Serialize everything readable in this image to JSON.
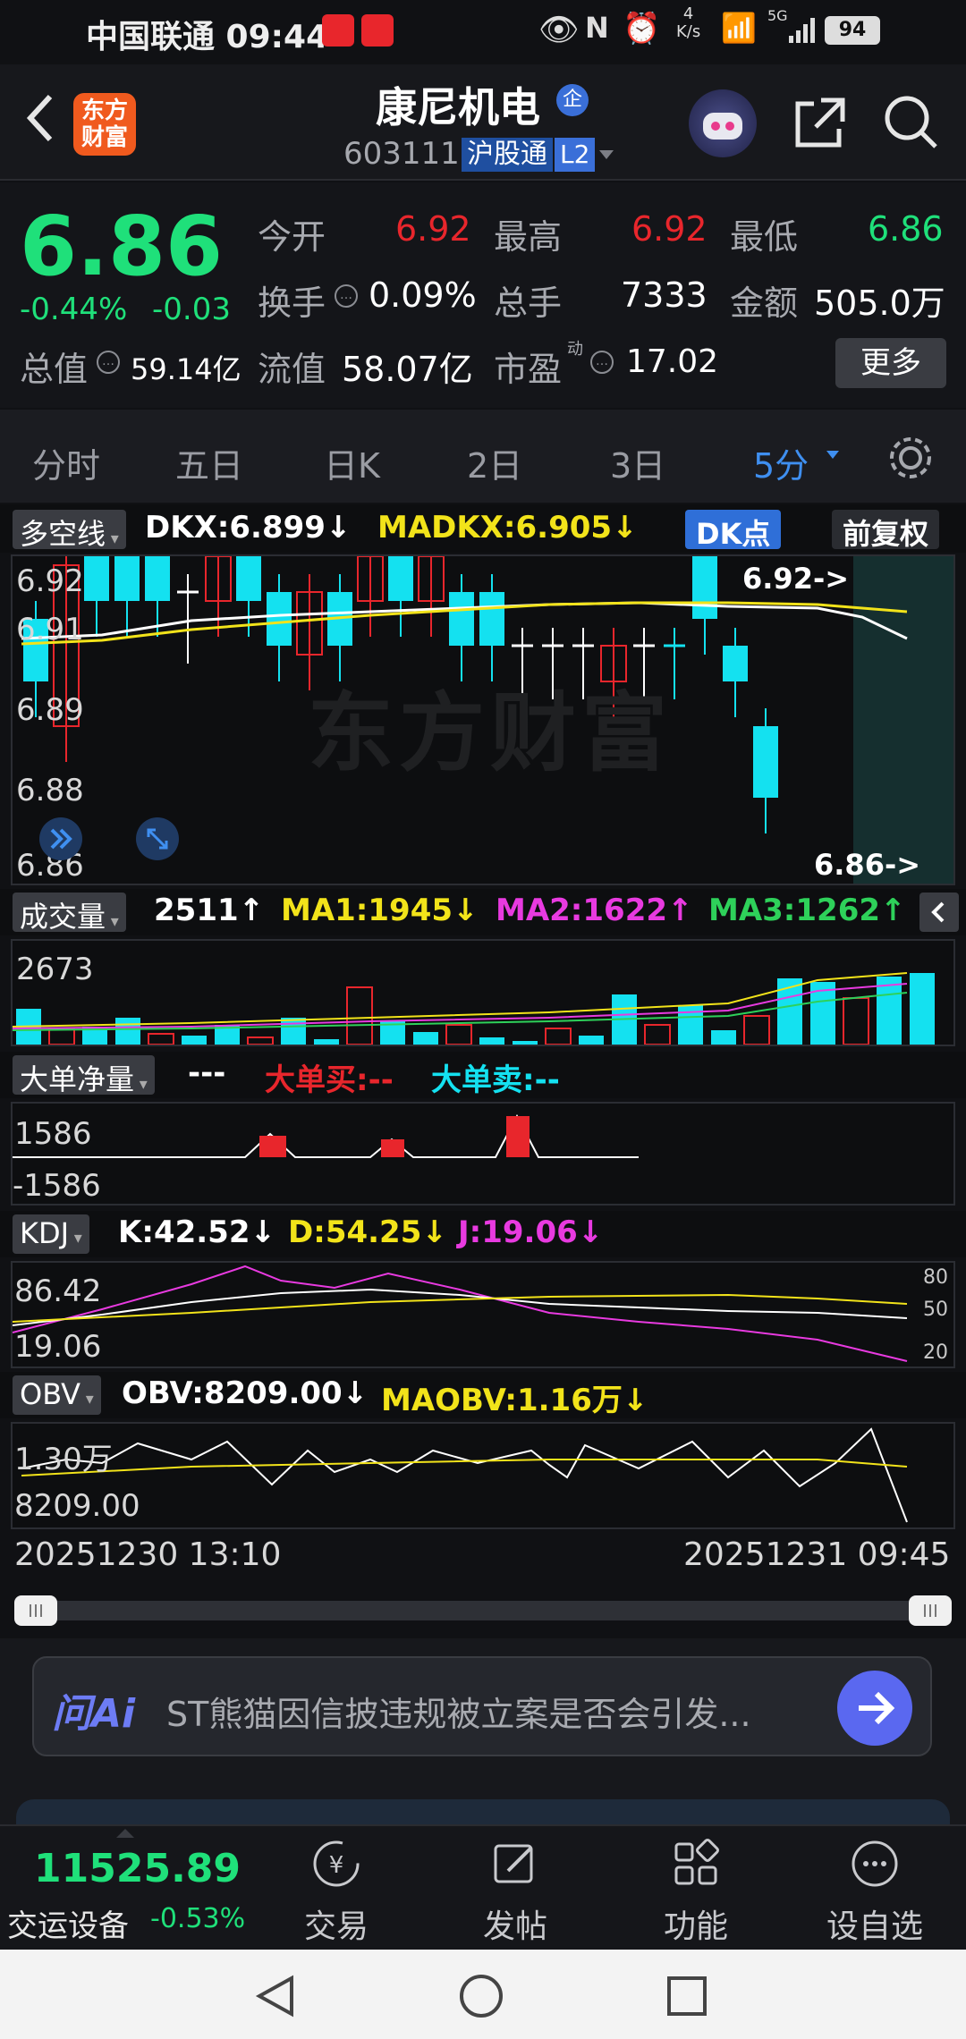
{
  "status_bar": {
    "carrier_time": "中国联通 09:44",
    "speed_top": "4",
    "speed_unit": "K/s",
    "signal": "5G",
    "battery": "94"
  },
  "header": {
    "logo_line1": "东方",
    "logo_line2": "财富",
    "stock_name": "康尼机电",
    "badge_qi": "企",
    "code": "603111",
    "hgt": "沪股通",
    "level": "L2"
  },
  "quote": {
    "price": "6.86",
    "change_pct": "-0.44%",
    "change": "-0.03",
    "open_label": "今开",
    "open": "6.92",
    "high_label": "最高",
    "high": "6.92",
    "low_label": "最低",
    "low": "6.86",
    "turnover_label": "换手",
    "turnover": "0.09%",
    "volume_label": "总手",
    "volume": "7333",
    "amount_label": "金额",
    "amount": "505.0万",
    "mcap_label": "总值",
    "mcap": "59.14亿",
    "float_label": "流值",
    "float": "58.07亿",
    "pe_label": "市盈",
    "pe_sup": "动",
    "pe": "17.02",
    "more_label": "更多"
  },
  "tabs": [
    "分时",
    "五日",
    "日K",
    "2日",
    "3日",
    "5分"
  ],
  "main_chart": {
    "indicator_name": "多空线",
    "dkx": "DKX:6.899↓",
    "madkx": "MADKX:6.905↓",
    "dk_point": "DK点",
    "fq": "前复权",
    "y_labels": [
      "6.92",
      "6.91",
      "6.89",
      "6.88",
      "6.86"
    ],
    "high_mark": "6.92->",
    "low_mark": "6.86->",
    "watermark": "东方财富"
  },
  "volume_panel": {
    "name": "成交量",
    "value": "2511↑",
    "ma1": "MA1:1945↓",
    "ma2": "MA2:1622↑",
    "ma3": "MA3:1262↑",
    "y_top": "2673"
  },
  "bigorder_panel": {
    "name": "大单净量",
    "dash": "---",
    "buy": "大单买:--",
    "sell": "大单卖:--",
    "y_top": "1586",
    "y_bottom": "-1586"
  },
  "kdj_panel": {
    "name": "KDJ",
    "k": "K:42.52↓",
    "d": "D:54.25↓",
    "j": "J:19.06↓",
    "y_top": "86.42",
    "y_bottom": "19.06",
    "r80": "80",
    "r50": "50",
    "r20": "20"
  },
  "obv_panel": {
    "name": "OBV",
    "obv": "OBV:8209.00↓",
    "maobv": "MAOBV:1.16万↓",
    "y_top": "1.30万",
    "y_bottom": "8209.00"
  },
  "time_axis": {
    "start": "20251230 13:10",
    "end": "20251231 09:45"
  },
  "ai_bar": {
    "logo": "问Ai",
    "text": "ST熊猫因信披违规被立案是否会引发..."
  },
  "bottom_nav": {
    "index_value": "11525.89",
    "index_name": "交运设备",
    "index_change": "-0.53%",
    "trade": "交易",
    "post": "发帖",
    "func": "功能",
    "add": "设自选"
  },
  "colors": {
    "up": "#e8262c",
    "down": "#1fe07a",
    "cyan": "#14e1f0",
    "yellow": "#f2e31a",
    "magenta": "#e83ae0",
    "blue_accent": "#3f8ff0"
  }
}
